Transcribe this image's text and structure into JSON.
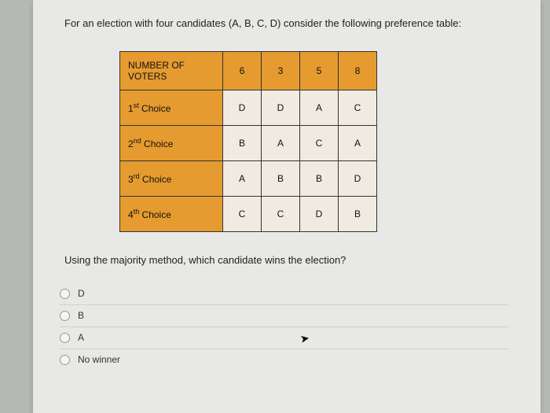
{
  "question": "For an election with four candidates (A, B, C, D) consider the following preference table:",
  "table": {
    "header_label": "NUMBER OF VOTERS",
    "voter_counts": [
      "6",
      "3",
      "5",
      "8"
    ],
    "rows": [
      {
        "label_pre": "1",
        "label_sup": "st",
        "label_post": " Choice",
        "cells": [
          "D",
          "D",
          "A",
          "C"
        ]
      },
      {
        "label_pre": "2",
        "label_sup": "nd",
        "label_post": " Choice",
        "cells": [
          "B",
          "A",
          "C",
          "A"
        ]
      },
      {
        "label_pre": "3",
        "label_sup": "rd",
        "label_post": " Choice",
        "cells": [
          "A",
          "B",
          "B",
          "D"
        ]
      },
      {
        "label_pre": "4",
        "label_sup": "th",
        "label_post": " Choice",
        "cells": [
          "C",
          "C",
          "D",
          "B"
        ]
      }
    ]
  },
  "followup": "Using the majority method, which candidate wins the election?",
  "options": [
    "D",
    "B",
    "A",
    "No winner"
  ]
}
